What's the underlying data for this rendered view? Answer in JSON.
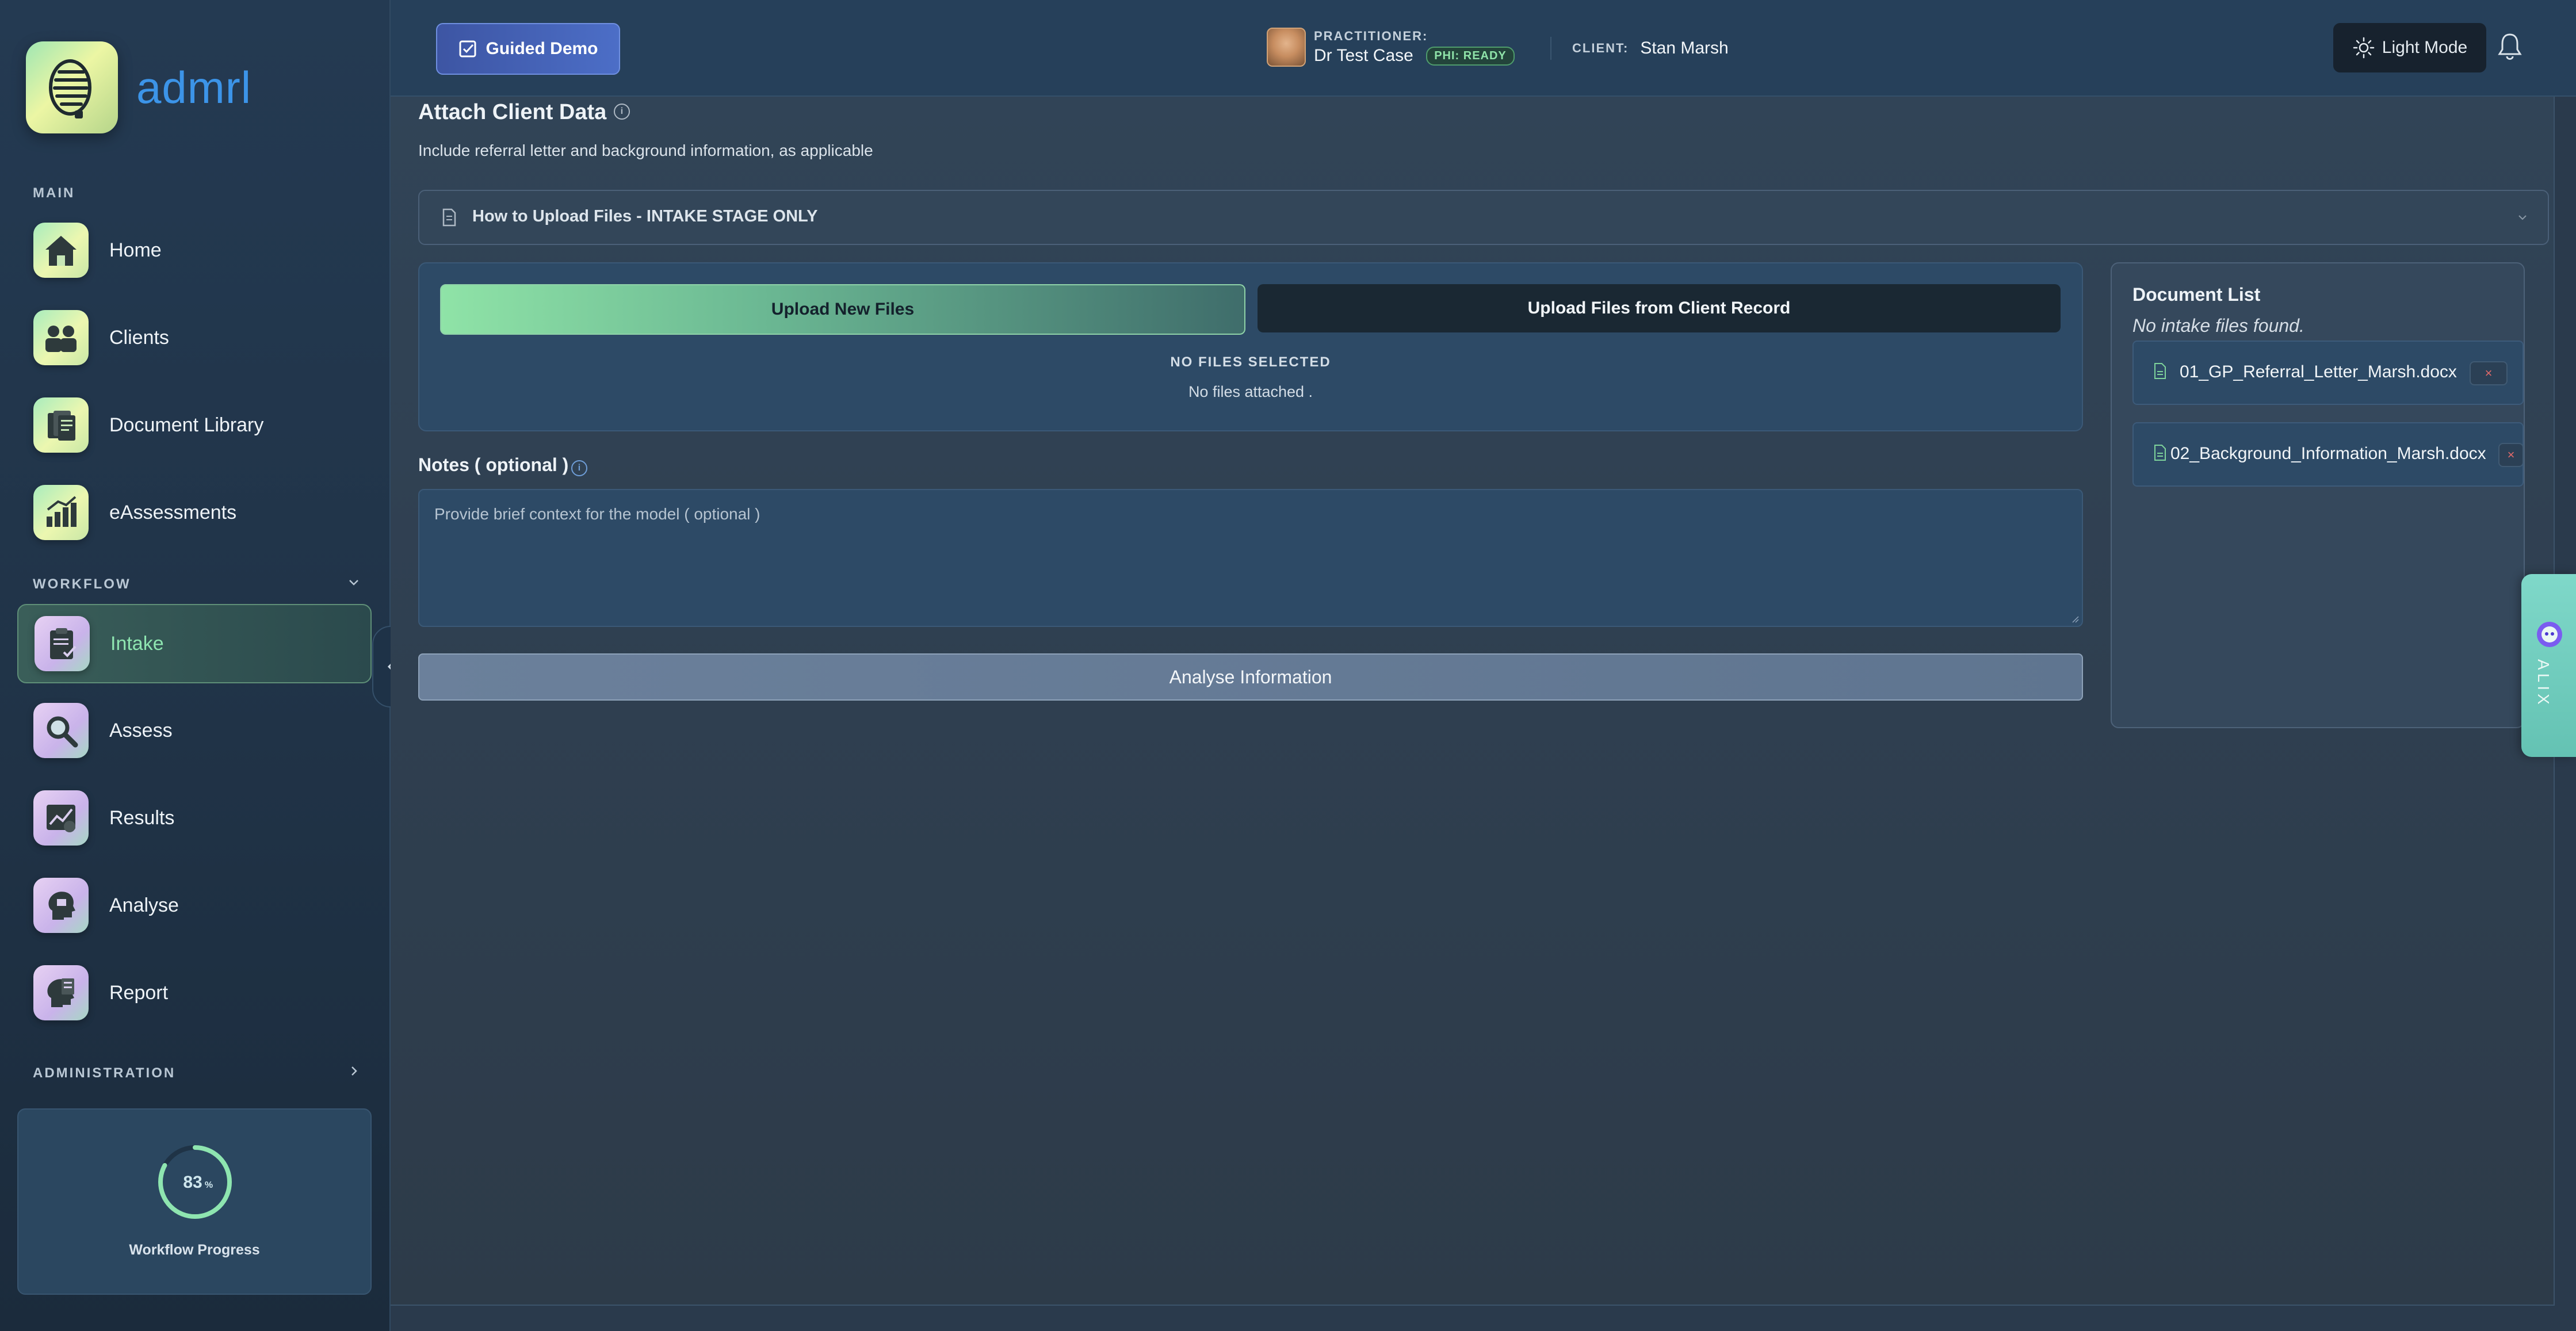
{
  "brand": {
    "name": "admrl"
  },
  "sidebar": {
    "main_label": "MAIN",
    "workflow_label": "WORKFLOW",
    "admin_label": "ADMINISTRATION",
    "main_items": [
      {
        "label": "Home",
        "icon": "home-icon"
      },
      {
        "label": "Clients",
        "icon": "clients-icon"
      },
      {
        "label": "Document Library",
        "icon": "document-library-icon"
      },
      {
        "label": "eAssessments",
        "icon": "eassessments-icon"
      }
    ],
    "workflow_items": [
      {
        "label": "Intake",
        "icon": "intake-icon",
        "active": true
      },
      {
        "label": "Assess",
        "icon": "assess-icon"
      },
      {
        "label": "Results",
        "icon": "results-icon"
      },
      {
        "label": "Analyse",
        "icon": "analyse-icon"
      },
      {
        "label": "Report",
        "icon": "report-icon"
      }
    ],
    "progress": {
      "value": "83",
      "unit": "%",
      "fraction": 0.83,
      "label": "Workflow Progress"
    }
  },
  "topbar": {
    "guided_demo_label": "Guided Demo",
    "practitioner_label": "PRACTITIONER:",
    "practitioner_name": "Dr Test Case",
    "phi_badge": "PHI: READY",
    "client_label": "CLIENT:",
    "client_name": "Stan Marsh",
    "light_mode_label": "Light Mode"
  },
  "main": {
    "title": "Attach Client Data",
    "subtitle": "Include referral letter and background information, as applicable",
    "accordion_title": "How to Upload Files - INTAKE STAGE ONLY",
    "tabs": {
      "upload_new": "Upload New Files",
      "upload_from_record": "Upload Files from Client Record"
    },
    "no_files_selected": "NO FILES SELECTED",
    "no_files_attached": "No files attached .",
    "notes_label": "Notes ( optional )",
    "notes_placeholder": "Provide brief context for the model ( optional )",
    "analyse_button": "Analyse Information"
  },
  "documents": {
    "title": "Document List",
    "empty_text": "No intake files found.",
    "files": [
      {
        "name": "01_GP_Referral_Letter_Marsh.docx",
        "remove": "×"
      },
      {
        "name": "02_Background_Information_Marsh.docx",
        "remove": "×"
      }
    ]
  },
  "assistant": {
    "label": "ALIX"
  },
  "colors": {
    "accent": "#3c94e8",
    "active_green": "#8ee5b0",
    "danger": "#e36a6a"
  }
}
